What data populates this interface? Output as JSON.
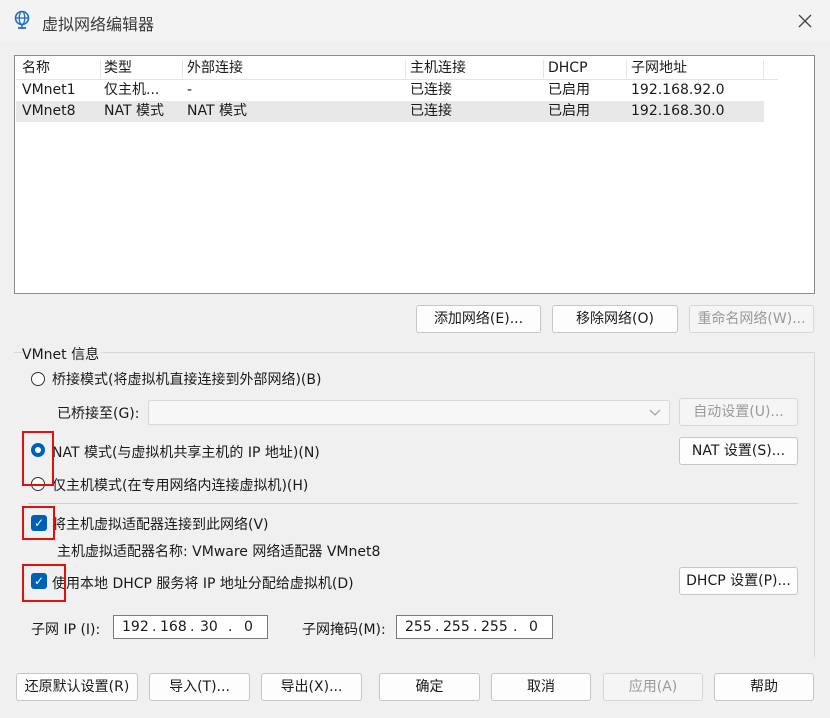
{
  "window": {
    "title": "虚拟网络编辑器",
    "icon": "network-globe-icon"
  },
  "table": {
    "headers": [
      "名称",
      "类型",
      "外部连接",
      "主机连接",
      "DHCP",
      "子网地址"
    ],
    "rows": [
      [
        "VMnet1",
        "仅主机...",
        "-",
        "已连接",
        "已启用",
        "192.168.92.0"
      ],
      [
        "VMnet8",
        "NAT 模式",
        "NAT 模式",
        "已连接",
        "已启用",
        "192.168.30.0"
      ]
    ],
    "selected_row": 1
  },
  "list_buttons": {
    "add": "添加网络(E)...",
    "remove": "移除网络(O)",
    "rename": "重命名网络(W)..."
  },
  "vmnet_info": {
    "group_label": "VMnet 信息",
    "bridge_label": "桥接模式(将虚拟机直接连接到外部网络)(B)",
    "bridged_to_label": "已桥接至(G):",
    "bridged_to_value": "",
    "auto_settings": "自动设置(U)...",
    "nat_label": "NAT 模式(与虚拟机共享主机的 IP 地址)(N)",
    "nat_settings": "NAT 设置(S)...",
    "hostonly_label": "仅主机模式(在专用网络内连接虚拟机)(H)",
    "connect_adapter_label": "将主机虚拟适配器连接到此网络(V)",
    "adapter_name_text": "主机虚拟适配器名称: VMware 网络适配器 VMnet8",
    "dhcp_label": "使用本地 DHCP 服务将 IP 地址分配给虚拟机(D)",
    "dhcp_settings": "DHCP 设置(P)...",
    "mode_selected": "nat",
    "connect_adapter_checked": true,
    "dhcp_checked": true
  },
  "subnet": {
    "ip_label": "子网 IP (I):",
    "ip": [
      "192",
      "168",
      "30",
      "0"
    ],
    "mask_label": "子网掩码(M):",
    "mask": [
      "255",
      "255",
      "255",
      "0"
    ]
  },
  "footer": {
    "restore": "还原默认设置(R)",
    "import": "导入(T)...",
    "export": "导出(X)...",
    "ok": "确定",
    "cancel": "取消",
    "apply": "应用(A)",
    "help": "帮助"
  },
  "colors": {
    "accent": "#005fb8",
    "highlight_box": "#e01010"
  }
}
